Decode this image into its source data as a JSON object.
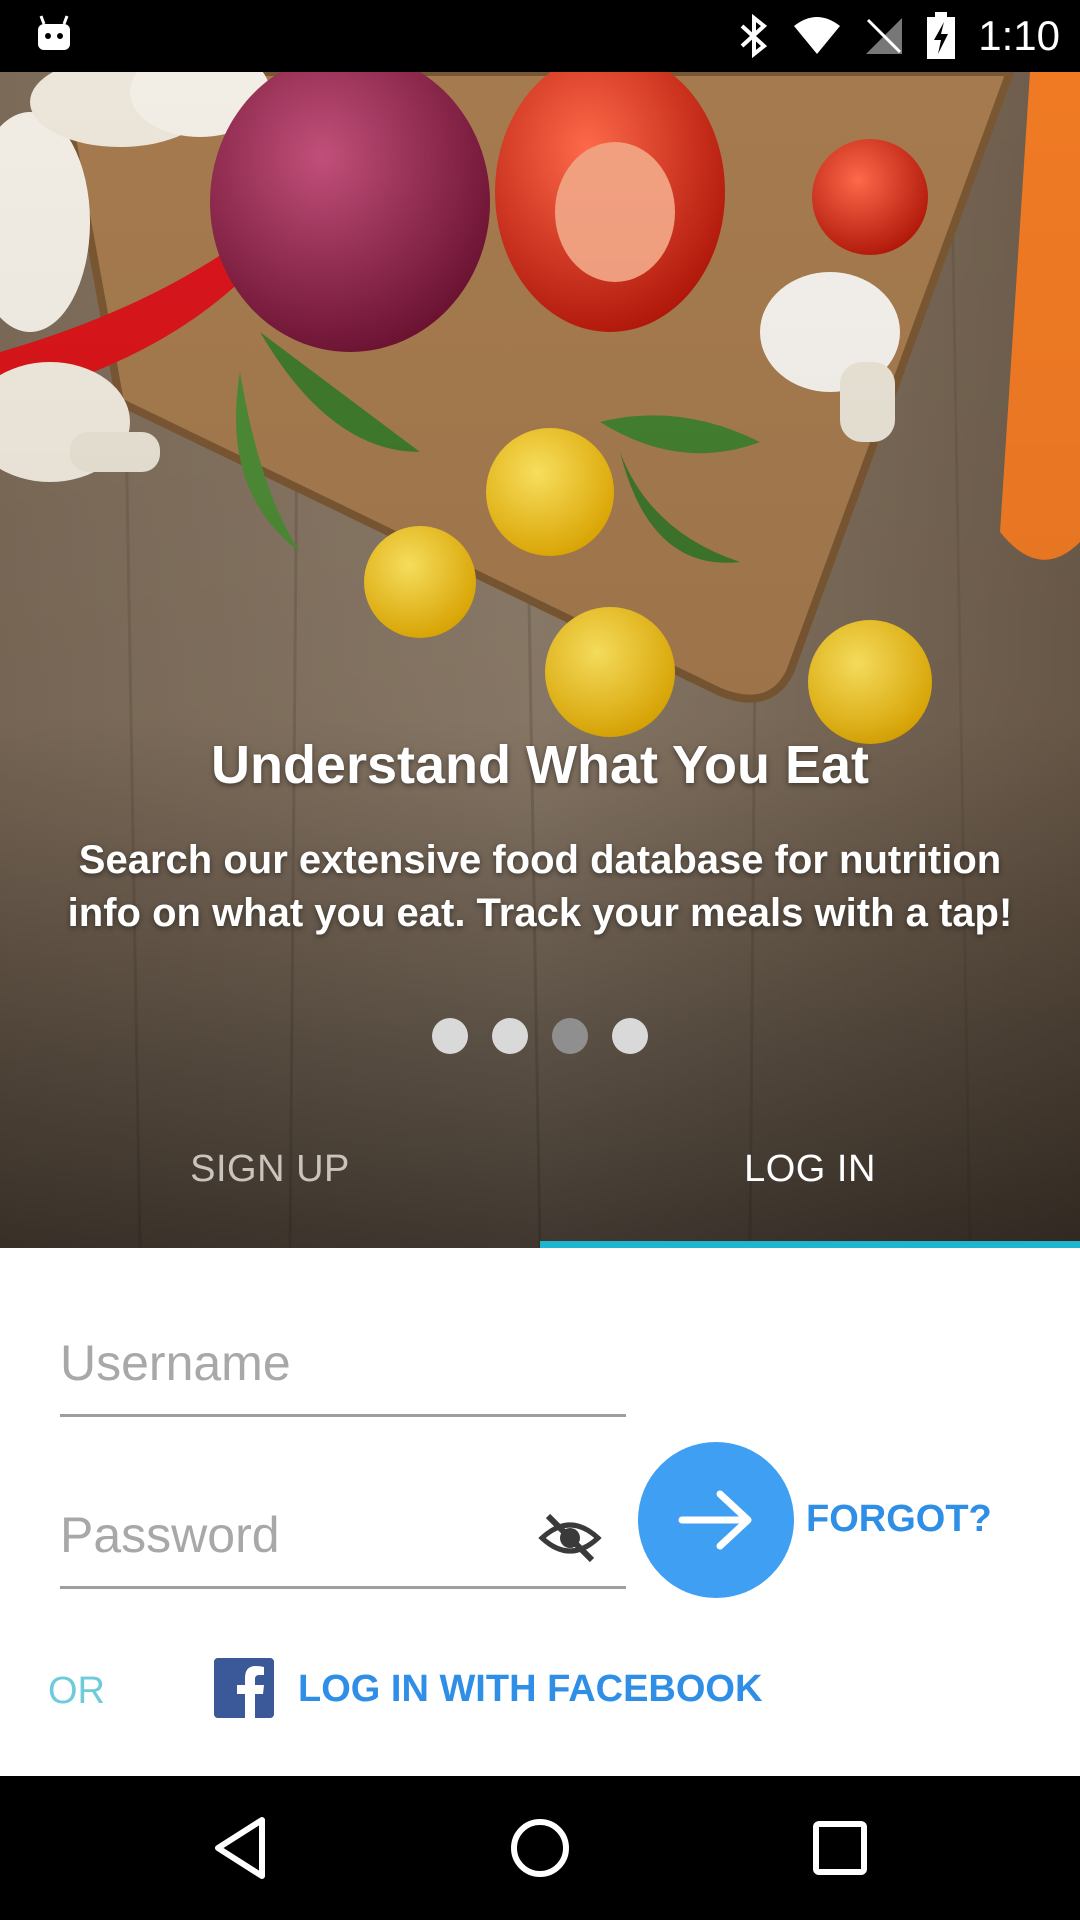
{
  "status_bar": {
    "time": "1:10",
    "icons": [
      "android-notification-icon",
      "bluetooth-icon",
      "wifi-icon",
      "no-signal-icon",
      "battery-charging-icon"
    ]
  },
  "hero": {
    "title": "Understand What You Eat",
    "body": "Search our extensive food database for nutrition info on what you eat.  Track your meals with a tap!",
    "page_count": 4,
    "active_page": 3
  },
  "tabs": {
    "sign_up": "SIGN UP",
    "log_in": "LOG IN",
    "selected": "LOG IN"
  },
  "form": {
    "username_placeholder": "Username",
    "username_value": "",
    "password_placeholder": "Password",
    "password_value": "",
    "forgot_label": "FORGOT?",
    "or_label": "OR",
    "facebook_label": "LOG IN WITH FACEBOOK"
  },
  "colors": {
    "accent_blue": "#3f9ff2",
    "link_blue": "#2f8fe6",
    "tab_indicator": "#1fb5cf",
    "facebook_blue": "#3b5998"
  }
}
